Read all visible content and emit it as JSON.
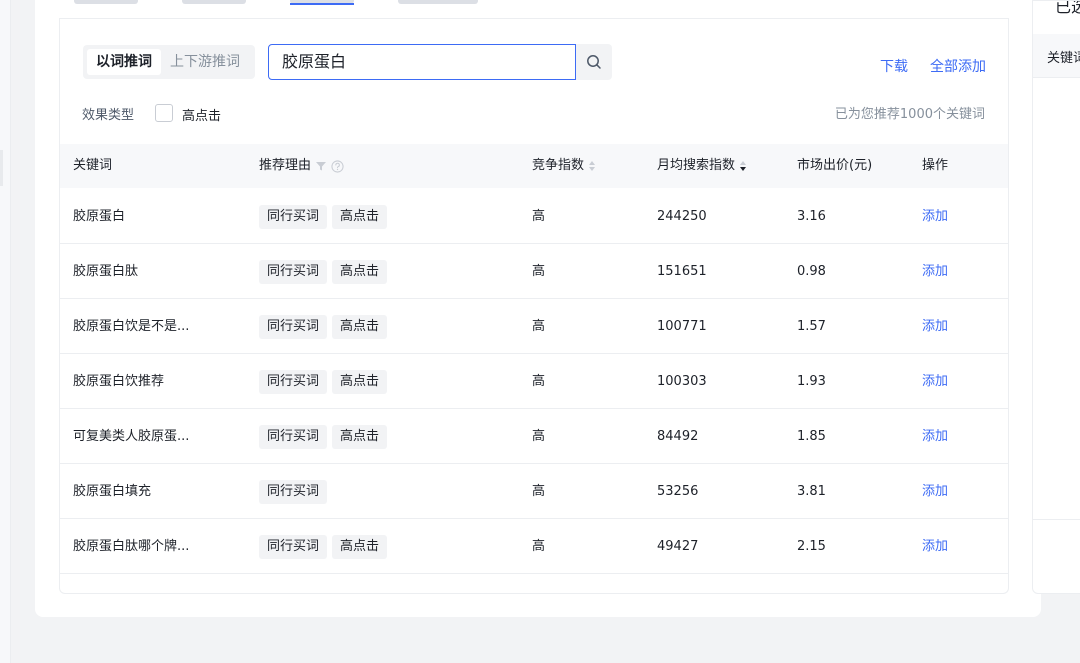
{
  "mode_toggle": {
    "options": [
      "以词推词",
      "上下游推词"
    ],
    "active": "以词推词"
  },
  "search": {
    "value": "胶原蛋白"
  },
  "actions": {
    "download": "下载",
    "add_all": "全部添加"
  },
  "filter": {
    "label": "效果类型",
    "checkbox_label": "高点击"
  },
  "result_count": "已为您推荐1000个关键词",
  "table": {
    "headers": {
      "keyword": "关键词",
      "reason": "推荐理由",
      "competition": "竞争指数",
      "monthly_search": "月均搜索指数",
      "price": "市场出价(元)",
      "action": "操作"
    },
    "rows": [
      {
        "keyword": "胶原蛋白",
        "tags": [
          "同行买词",
          "高点击"
        ],
        "competition": "高",
        "monthly_search": "244250",
        "price": "3.16",
        "action": "添加"
      },
      {
        "keyword": "胶原蛋白肽",
        "tags": [
          "同行买词",
          "高点击"
        ],
        "competition": "高",
        "monthly_search": "151651",
        "price": "0.98",
        "action": "添加"
      },
      {
        "keyword": "胶原蛋白饮是不是...",
        "tags": [
          "同行买词",
          "高点击"
        ],
        "competition": "高",
        "monthly_search": "100771",
        "price": "1.57",
        "action": "添加"
      },
      {
        "keyword": "胶原蛋白饮推荐",
        "tags": [
          "同行买词",
          "高点击"
        ],
        "competition": "高",
        "monthly_search": "100303",
        "price": "1.93",
        "action": "添加"
      },
      {
        "keyword": "可复美类人胶原蛋...",
        "tags": [
          "同行买词",
          "高点击"
        ],
        "competition": "高",
        "monthly_search": "84492",
        "price": "1.85",
        "action": "添加"
      },
      {
        "keyword": "胶原蛋白填充",
        "tags": [
          "同行买词"
        ],
        "competition": "高",
        "monthly_search": "53256",
        "price": "3.81",
        "action": "添加"
      },
      {
        "keyword": "胶原蛋白肽哪个牌...",
        "tags": [
          "同行买词",
          "高点击"
        ],
        "competition": "高",
        "monthly_search": "49427",
        "price": "2.15",
        "action": "添加"
      }
    ]
  },
  "right_panel": {
    "title": "已选",
    "header": "关键词"
  },
  "colors": {
    "accent": "#3d6bf5",
    "header_bg": "#f7f8fa",
    "tag_bg": "#f2f3f5"
  }
}
